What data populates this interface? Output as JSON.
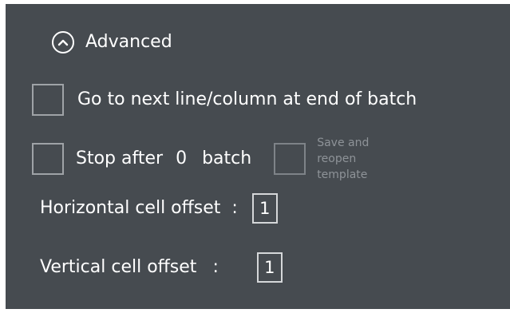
{
  "section": {
    "title": "Advanced",
    "toggle_icon": "chevron-up-circle-icon",
    "expanded": true
  },
  "next_line_option": {
    "label": "Go to next line/column at end of batch",
    "checked": false
  },
  "stop_option": {
    "prefix": "Stop after",
    "count": "0",
    "suffix": "batch",
    "checked": false
  },
  "save_reopen_option": {
    "label": "Save and reopen template",
    "checked": false,
    "enabled": false
  },
  "horizontal_offset": {
    "label": "Horizontal cell offset",
    "separator": ":",
    "value": "1"
  },
  "vertical_offset": {
    "label": "Vertical cell offset",
    "separator": ":",
    "value": "1"
  },
  "colors": {
    "panel_background": "#464b50",
    "text": "#ffffff",
    "checkbox_border": "#9fa3a7",
    "disabled_text": "#8e9398"
  }
}
